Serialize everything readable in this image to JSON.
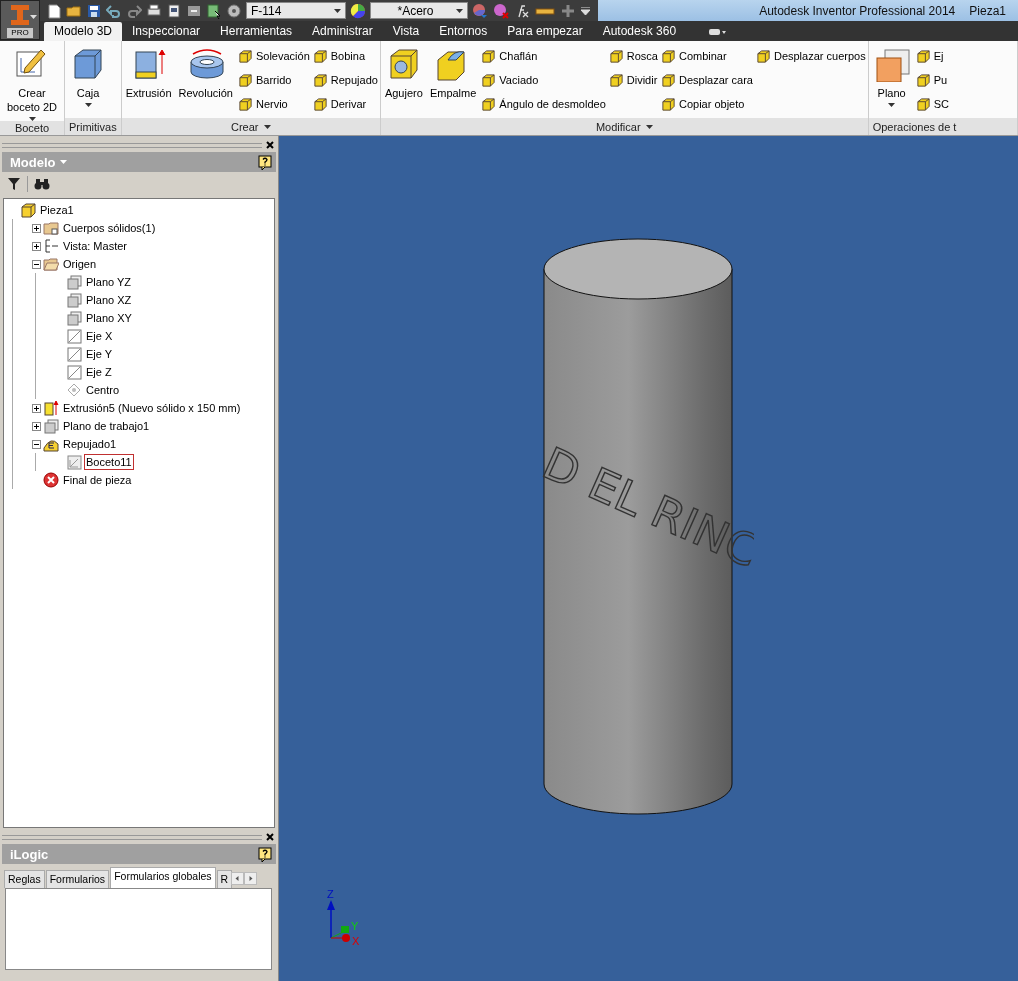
{
  "app_button": {
    "label": "PRO"
  },
  "quick_access": {
    "part_number": "F-114",
    "material": "*Acero"
  },
  "title": {
    "app": "Autodesk Inventor Professional 2014",
    "document": "Pieza1"
  },
  "tabs": [
    {
      "label": "Modelo 3D",
      "selected": true
    },
    {
      "label": "Inspeccionar",
      "selected": false
    },
    {
      "label": "Herramientas",
      "selected": false
    },
    {
      "label": "Administrar",
      "selected": false
    },
    {
      "label": "Vista",
      "selected": false
    },
    {
      "label": "Entornos",
      "selected": false
    },
    {
      "label": "Para empezar",
      "selected": false
    },
    {
      "label": "Autodesk 360",
      "selected": false
    }
  ],
  "ribbon": {
    "panels": [
      {
        "title": "Boceto",
        "menu": false,
        "tools": [
          {
            "kind": "large",
            "label": "Crear boceto 2D",
            "dropdown": true
          }
        ]
      },
      {
        "title": "Primitivas",
        "menu": false,
        "tools": [
          {
            "kind": "large",
            "label": "Caja",
            "dropdown": true
          }
        ]
      },
      {
        "title": "Crear",
        "menu": true,
        "tools": [
          {
            "kind": "large",
            "label": "Extrusión",
            "dropdown": false
          },
          {
            "kind": "large",
            "label": "Revolución",
            "dropdown": false
          },
          {
            "kind": "column",
            "items": [
              "Solevación",
              "Barrido",
              "Nervio"
            ]
          },
          {
            "kind": "column",
            "items": [
              "Bobina",
              "Repujado",
              "Derivar"
            ]
          }
        ]
      },
      {
        "title": "Modificar",
        "menu": true,
        "tools": [
          {
            "kind": "large",
            "label": "Agujero",
            "dropdown": false
          },
          {
            "kind": "large",
            "label": "Empalme",
            "dropdown": false
          },
          {
            "kind": "column",
            "items": [
              "Chaflán",
              "Vaciado",
              "Ángulo de desmoldeo"
            ]
          },
          {
            "kind": "column",
            "items": [
              "Rosca",
              "Dividir"
            ]
          },
          {
            "kind": "column",
            "items": [
              "Combinar",
              "Desplazar cara",
              "Copiar objeto"
            ]
          },
          {
            "kind": "column",
            "items": [
              "Desplazar cuerpos"
            ]
          }
        ]
      },
      {
        "title": "Operaciones de t",
        "menu": false,
        "tools": [
          {
            "kind": "large",
            "label": "Plano",
            "dropdown": true
          },
          {
            "kind": "column",
            "items": [
              "Ej",
              "Pu",
              "SC"
            ]
          }
        ]
      }
    ]
  },
  "browser": {
    "title": "Modelo",
    "tree": [
      {
        "label": "Pieza1",
        "selected": false,
        "children": [
          {
            "label": "Cuerpos sólidos(1)",
            "selected": false,
            "expanded": false
          },
          {
            "label": "Vista: Master",
            "selected": false,
            "expanded": false
          },
          {
            "label": "Origen",
            "selected": false,
            "expanded": true,
            "children": [
              {
                "label": "Plano YZ",
                "selected": false
              },
              {
                "label": "Plano XZ",
                "selected": false
              },
              {
                "label": "Plano XY",
                "selected": false
              },
              {
                "label": "Eje X",
                "selected": false
              },
              {
                "label": "Eje Y",
                "selected": false
              },
              {
                "label": "Eje Z",
                "selected": false
              },
              {
                "label": "Centro",
                "selected": false
              }
            ]
          },
          {
            "label": "Extrusión5 (Nuevo sólido x 150 mm)",
            "selected": false,
            "expanded": false
          },
          {
            "label": "Plano de trabajo1",
            "selected": false,
            "expanded": false
          },
          {
            "label": "Repujado1",
            "selected": false,
            "expanded": true,
            "children": [
              {
                "label": "Boceto11",
                "selected": true
              }
            ]
          },
          {
            "label": "Final de pieza",
            "selected": false
          }
        ]
      }
    ]
  },
  "ilogic": {
    "title": "iLogic",
    "tabs": [
      {
        "label": "Reglas",
        "selected": false
      },
      {
        "label": "Formularios",
        "selected": false
      },
      {
        "label": "Formularios globales",
        "selected": true
      },
      {
        "label": "R",
        "selected": false
      }
    ]
  },
  "viewport": {
    "embossed_text": "D EL RINC",
    "axes": [
      "Z",
      "Y",
      "X"
    ]
  }
}
